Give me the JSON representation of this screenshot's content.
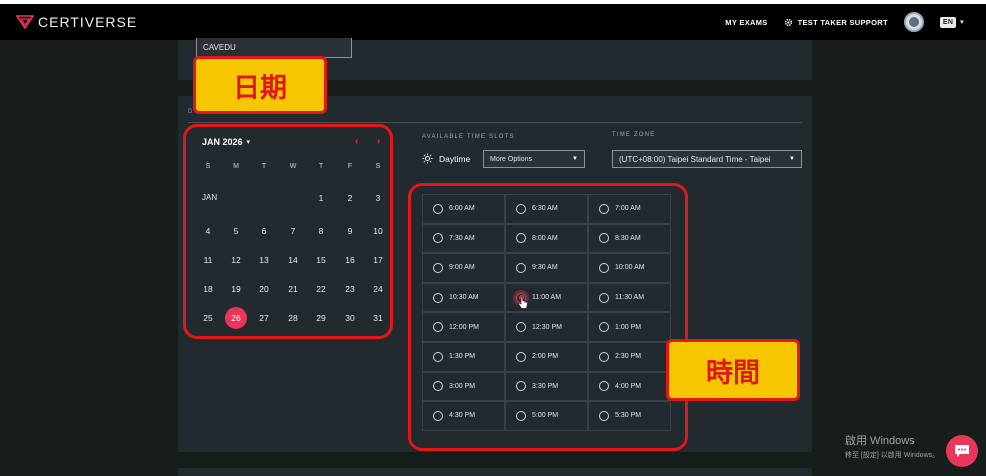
{
  "header": {
    "logo_text": "CERTIVERSE",
    "my_exams": "MY EXAMS",
    "support": "TEST TAKER SUPPORT",
    "lang": "EN"
  },
  "org_field": {
    "value": "CAVEDU"
  },
  "section": {
    "label": "D"
  },
  "calendar": {
    "month_label": "JAN 2026",
    "dow": [
      "S",
      "M",
      "T",
      "W",
      "T",
      "F",
      "S"
    ],
    "month_abbr": "JAN",
    "days": [
      "1",
      "2",
      "3",
      "4",
      "5",
      "6",
      "7",
      "8",
      "9",
      "10",
      "11",
      "12",
      "13",
      "14",
      "15",
      "16",
      "17",
      "18",
      "19",
      "20",
      "21",
      "22",
      "23",
      "24",
      "25",
      "26",
      "27",
      "28",
      "29",
      "30",
      "31"
    ],
    "selected_day": "26",
    "prev_symbol": "‹",
    "next_symbol": "›"
  },
  "time_slots": {
    "label": "AVAILABLE TIME SLOTS",
    "period": "Daytime",
    "more_options": "More Options",
    "selected": "11:00 AM",
    "slots": [
      "6:00 AM",
      "6:30 AM",
      "7:00 AM",
      "7:30 AM",
      "8:00 AM",
      "8:30 AM",
      "9:00 AM",
      "9:30 AM",
      "10:00 AM",
      "10:30 AM",
      "11:00 AM",
      "11:30 AM",
      "12:00 PM",
      "12:30 PM",
      "1:00 PM",
      "1:30 PM",
      "2:00 PM",
      "2:30 PM",
      "3:00 PM",
      "3:30 PM",
      "4:00 PM",
      "4:30 PM",
      "5:00 PM",
      "5:30 PM"
    ]
  },
  "time_zone": {
    "label": "TIME ZONE",
    "value": "(UTC+08:00) Taipei Standard Time - Taipei"
  },
  "annotations": {
    "date_tag": "日期",
    "time_tag": "時間"
  },
  "watermark": {
    "line1": "啟用 Windows",
    "line2": "移至 [設定] 以啟用 Windows。"
  },
  "colors": {
    "accent": "#e8375a",
    "annotation_red": "#e01818",
    "annotation_yellow": "#f6c600"
  }
}
